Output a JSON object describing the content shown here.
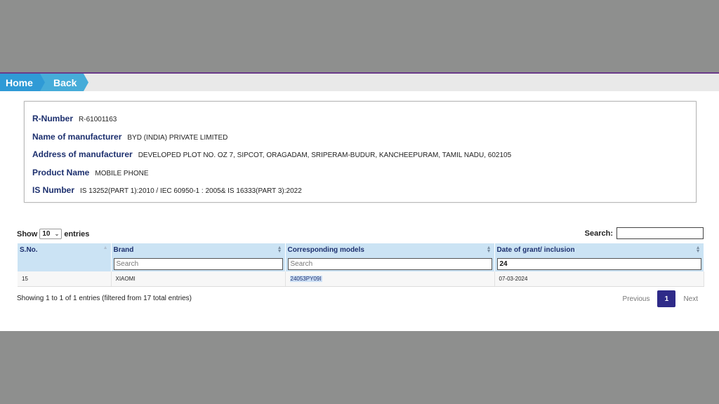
{
  "nav": {
    "home_label": "Home",
    "back_label": "Back"
  },
  "info": [
    {
      "label": "R-Number",
      "value": "R-61001163"
    },
    {
      "label": "Name of manufacturer",
      "value": "BYD (INDIA) PRIVATE LIMITED"
    },
    {
      "label": "Address of manufacturer",
      "value": "DEVELOPED PLOT NO. OZ 7, SIPCOT, ORAGADAM, SRIPERAM-BUDUR, KANCHEEPURAM, TAMIL NADU, 602105"
    },
    {
      "label": "Product Name",
      "value": "MOBILE PHONE"
    },
    {
      "label": "IS Number",
      "value": "IS 13252(PART 1):2010 / IEC 60950-1 : 2005& IS 16333(PART 3):2022"
    }
  ],
  "length": {
    "show_label": "Show",
    "selected": "10",
    "entries_label": "entries"
  },
  "search": {
    "label": "Search:",
    "value": ""
  },
  "table": {
    "columns": [
      "S.No.",
      "Brand",
      "Corresponding models",
      "Date of grant/ inclusion"
    ],
    "filters": [
      {
        "placeholder": "Search",
        "value": ""
      },
      {
        "placeholder": "Search",
        "value": ""
      },
      {
        "placeholder": "",
        "value": "24"
      }
    ],
    "rows": [
      [
        "15",
        "XIAOMI",
        "24053PY09I",
        "07-03-2024"
      ]
    ]
  },
  "footer": {
    "showing": "Showing 1 to 1 of 1 entries (filtered from 17 total entries)",
    "previous": "Previous",
    "current_page": "1",
    "next": "Next"
  },
  "colors": {
    "header_bg": "#cbe3f4",
    "label_navy": "#1c2f6e",
    "page_active": "#2e2a88",
    "nav_blue": "#2f9ad6"
  }
}
